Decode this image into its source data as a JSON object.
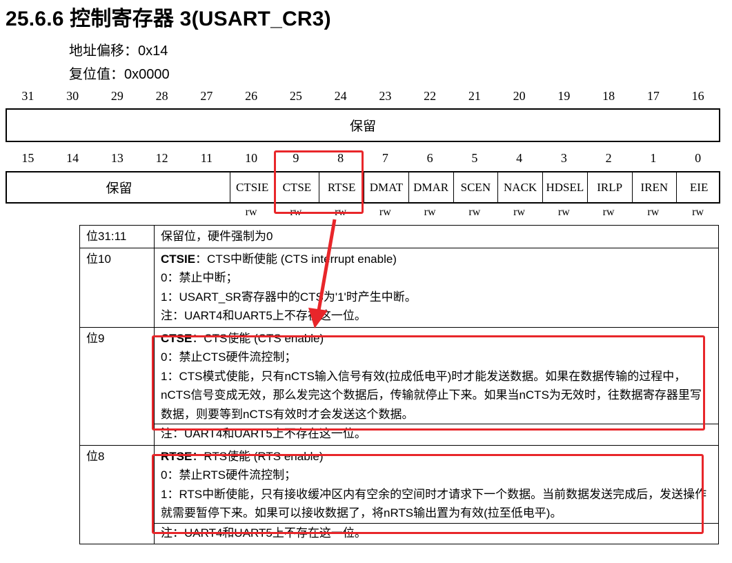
{
  "section": {
    "title": "25.6.6 控制寄存器 3(USART_CR3)"
  },
  "meta": {
    "offset": "地址偏移：0x14",
    "reset": "复位值：0x0000"
  },
  "upper": {
    "bits": [
      "31",
      "30",
      "29",
      "28",
      "27",
      "26",
      "25",
      "24",
      "23",
      "22",
      "21",
      "20",
      "19",
      "18",
      "17",
      "16"
    ],
    "reserved_label": "保留"
  },
  "lower": {
    "bits": [
      "15",
      "14",
      "13",
      "12",
      "11",
      "10",
      "9",
      "8",
      "7",
      "6",
      "5",
      "4",
      "3",
      "2",
      "1",
      "0"
    ],
    "reserved_label": "保留",
    "fields": [
      "CTSIE",
      "CTSE",
      "RTSE",
      "DMAT",
      "DMAR",
      "SCEN",
      "NACK",
      "HDSEL",
      "IRLP",
      "IREN",
      "EIE"
    ],
    "access": [
      "rw",
      "rw",
      "rw",
      "rw",
      "rw",
      "rw",
      "rw",
      "rw",
      "rw",
      "rw",
      "rw"
    ]
  },
  "rows": [
    {
      "bit": "位31:11",
      "lines": [
        "保留位，硬件强制为0"
      ]
    },
    {
      "bit": "位10",
      "name": "CTSIE",
      "head": "：CTS中断使能 (CTS interrupt enable)",
      "lines": [
        "0：禁止中断；",
        "1：USART_SR寄存器中的CTS为'1'时产生中断。"
      ],
      "note": "注：UART4和UART5上不存在这一位。"
    },
    {
      "bit": "位9",
      "name": "CTSE",
      "head": "：CTS使能 (CTS enable)",
      "lines": [
        "0：禁止CTS硬件流控制；",
        "1：CTS模式使能，只有nCTS输入信号有效(拉成低电平)时才能发送数据。如果在数据传输的过程中，nCTS信号变成无效，那么发完这个数据后，传输就停止下来。如果当nCTS为无效时，往数据寄存器里写数据，则要等到nCTS有效时才会发送这个数据。"
      ],
      "note": "注：UART4和UART5上不存在这一位。"
    },
    {
      "bit": "位8",
      "name": "RTSE",
      "head": "：RTS使能 (RTS enable)",
      "lines": [
        "0：禁止RTS硬件流控制；",
        "1：RTS中断使能，只有接收缓冲区内有空余的空间时才请求下一个数据。当前数据发送完成后，发送操作就需要暂停下来。如果可以接收数据了，将nRTS输出置为有效(拉至低电平)。"
      ],
      "note": "注：UART4和UART5上不存在这一位。"
    }
  ],
  "colors": {
    "highlight": "#e8262a"
  }
}
